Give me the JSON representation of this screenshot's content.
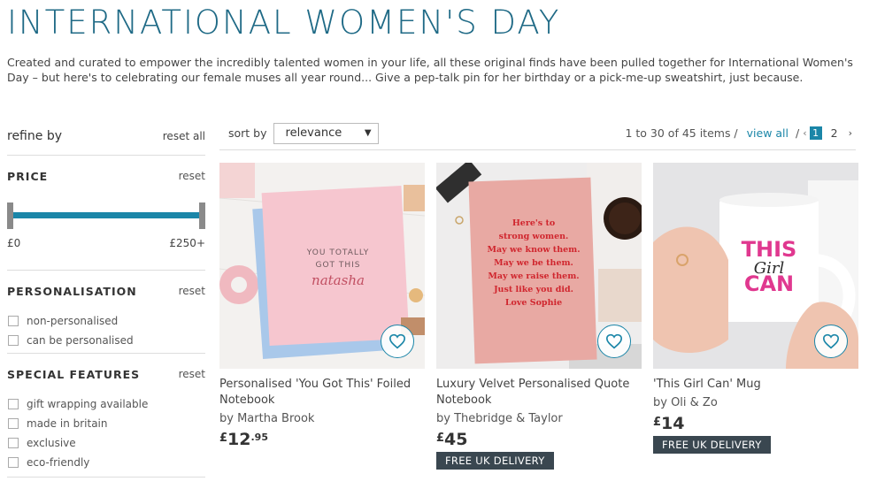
{
  "page": {
    "title": "INTERNATIONAL WOMEN'S DAY",
    "intro": "Created and curated to empower the incredibly talented women in your life, all these original finds have been pulled together for International Women's Day – but here's to celebrating our female muses all year round... Give a pep-talk pin for her birthday or a pick-me-up sweatshirt, just because."
  },
  "sidebar": {
    "refine_label": "refine by",
    "reset_all": "reset all",
    "price": {
      "heading": "PRICE",
      "reset": "reset",
      "min_label": "£0",
      "max_label": "£250+"
    },
    "personalisation": {
      "heading": "PERSONALISATION",
      "reset": "reset",
      "options": [
        "non-personalised",
        "can be personalised"
      ]
    },
    "special_features": {
      "heading": "SPECIAL FEATURES",
      "reset": "reset",
      "options": [
        "gift wrapping available",
        "made in britain",
        "exclusive",
        "eco-friendly"
      ]
    }
  },
  "toolbar": {
    "sort_label": "sort by",
    "sort_value": "relevance",
    "count_text": "1 to 30 of 45 items /",
    "view_all": "view all",
    "slash": "/",
    "prev": "‹",
    "current_page": "1",
    "page_2": "2",
    "next": "›"
  },
  "products": [
    {
      "title": "Personalised 'You Got This' Foiled Notebook",
      "by": "by Martha Brook",
      "price_currency": "£",
      "price_main": "12",
      "price_dec": ".95",
      "badge": "",
      "image_text_1": "YOU TOTALLY",
      "image_text_2": "GOT THIS",
      "image_text_3": "natasha"
    },
    {
      "title": "Luxury Velvet Personalised Quote Notebook",
      "by": "by Thebridge & Taylor",
      "price_currency": "£",
      "price_main": "45",
      "price_dec": "",
      "badge": "FREE UK DELIVERY",
      "image_lines": [
        "Here's to",
        "strong women.",
        "May we know them.",
        "May we be them.",
        "May we raise them.",
        "Just like you did.",
        "Love Sophie"
      ]
    },
    {
      "title": "'This Girl Can' Mug",
      "by": "by Oli & Zo",
      "price_currency": "£",
      "price_main": "14",
      "price_dec": "",
      "badge": "FREE UK DELIVERY",
      "image_text_1": "THIS",
      "image_text_2": "Girl",
      "image_text_3": "CAN"
    }
  ],
  "colors": {
    "accent": "#1b86a8",
    "title": "#1f6a86",
    "badge_bg": "#3a4750",
    "notebook_pink": "#f6c6cf",
    "velvet_pink": "#e8a9a3",
    "quote_red": "#d0262e",
    "mug_pink": "#e0388f"
  },
  "icons": [
    "heart-icon",
    "caret-down-icon",
    "chevron-left-icon",
    "chevron-right-icon"
  ]
}
